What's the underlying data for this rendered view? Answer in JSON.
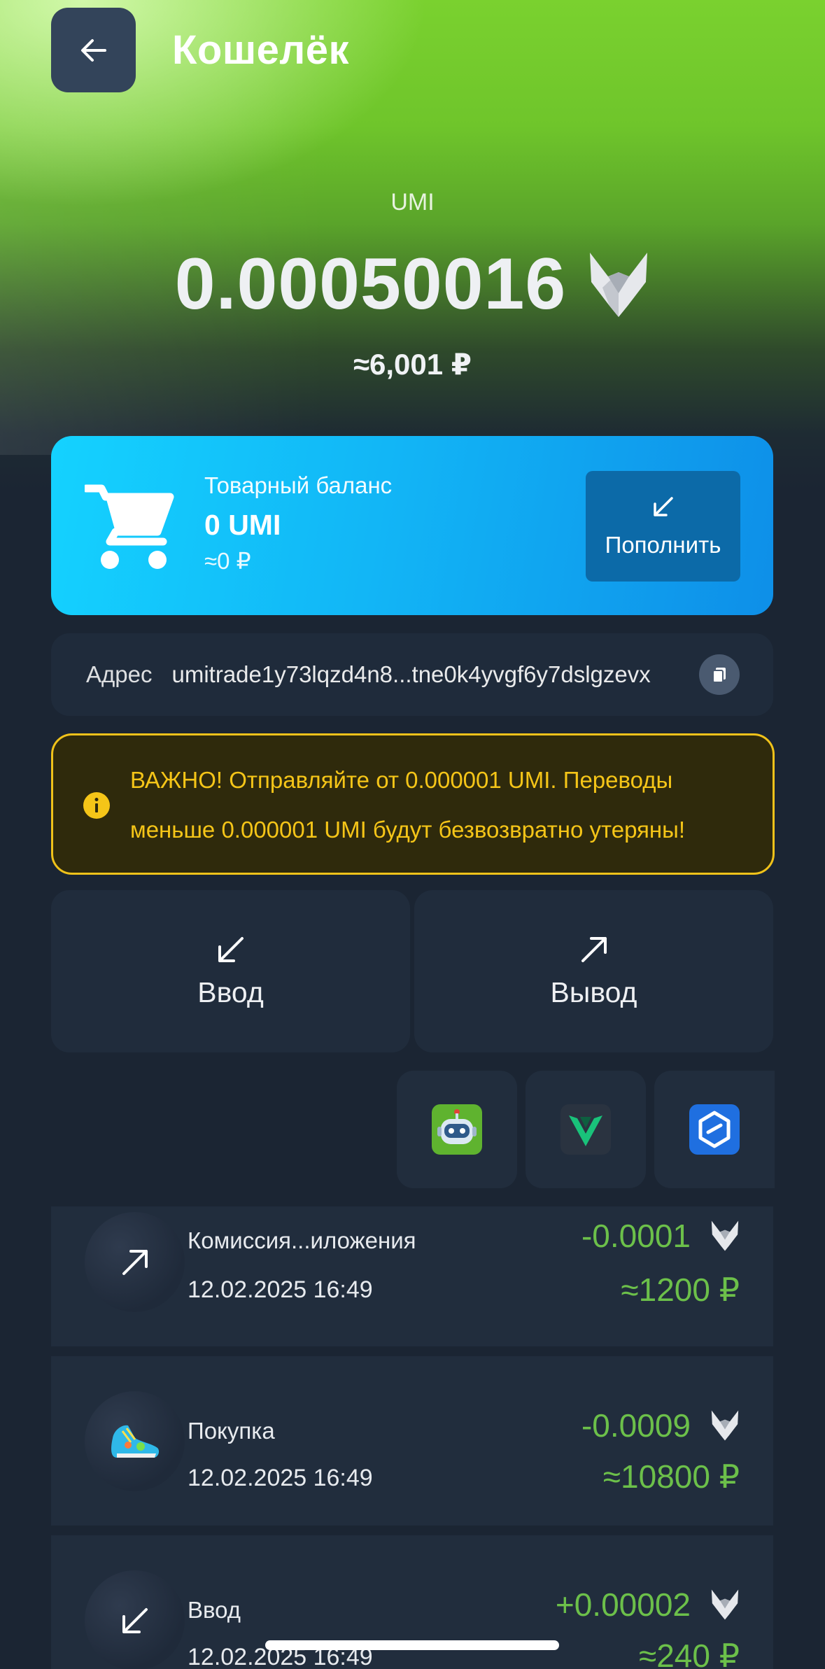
{
  "header": {
    "title": "Кошелёк",
    "back_icon": "arrow-left-icon"
  },
  "balance": {
    "currency": "UMI",
    "amount": "0.00050016",
    "fiat": "≈6,001 ₽",
    "logo_icon": "umi-logo-icon"
  },
  "goods_balance": {
    "label": "Товарный баланс",
    "value": "0 UMI",
    "fiat": "≈0 ₽",
    "topup_label": "Пополнить",
    "icon": "cart-icon"
  },
  "address": {
    "label": "Адрес",
    "value": "umitrade1y73lqzd4n8...tne0k4yvgf6y7dslgzevx"
  },
  "warning": {
    "text": "ВАЖНО! Отправляйте от 0.000001 UMI. Переводы меньше 0.000001 UMI будут безвозвратно утеряны!"
  },
  "actions": {
    "deposit_label": "Ввод",
    "withdraw_label": "Вывод"
  },
  "apps": [
    "robot-app-icon",
    "v-app-icon",
    "hexagon-app-icon"
  ],
  "transactions": [
    {
      "title": "Комиссия...иложения",
      "date": "12.02.2025 16:49",
      "amount": "-0.0001",
      "fiat": "≈1200 ₽",
      "icon": "arrow-up-right-icon"
    },
    {
      "title": "Покупка",
      "date": "12.02.2025 16:49",
      "amount": "-0.0009",
      "fiat": "≈10800 ₽",
      "icon": "sneaker-icon"
    },
    {
      "title": "Ввод",
      "date": "12.02.2025 16:49",
      "amount": "+0.00002",
      "fiat": "≈240 ₽",
      "icon": "arrow-down-left-icon"
    }
  ],
  "colors": {
    "accent_green": "#6cc04a",
    "warning_yellow": "#f5c518",
    "card_blue": "#12b6f6"
  }
}
